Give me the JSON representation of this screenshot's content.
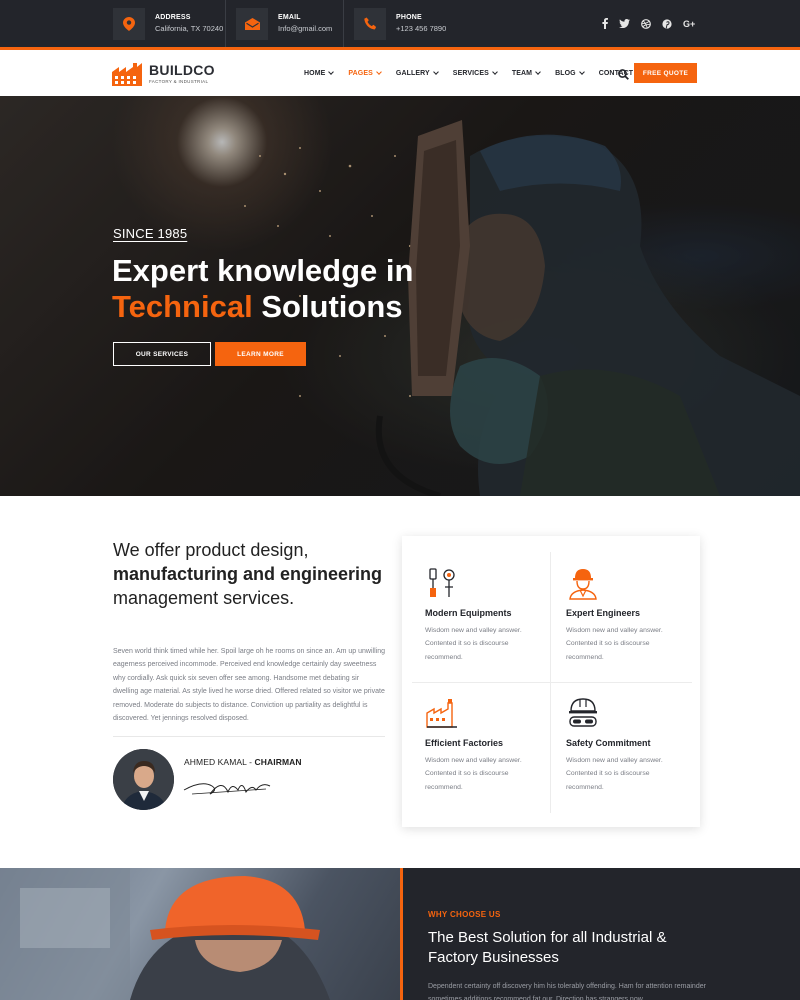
{
  "topbar": {
    "address": {
      "label": "ADDRESS",
      "value": "California, TX 70240",
      "icon": "map-pin-icon"
    },
    "email": {
      "label": "EMAIL",
      "value": "Info@gmail.com",
      "icon": "envelope-icon"
    },
    "phone": {
      "label": "PHONE",
      "value": "+123 456 7890",
      "icon": "phone-icon"
    },
    "social": [
      {
        "name": "facebook-icon",
        "glyph": "f"
      },
      {
        "name": "twitter-icon",
        "glyph": "t"
      },
      {
        "name": "dribbble-icon",
        "glyph": "d"
      },
      {
        "name": "pinterest-icon",
        "glyph": "p"
      },
      {
        "name": "google-plus-icon",
        "glyph": "G+"
      }
    ]
  },
  "nav": {
    "brand": "BUILDCO",
    "tagline": "FACTORY & INDUSTRIAL",
    "items": [
      {
        "label": "HOME",
        "dropdown": true
      },
      {
        "label": "PAGES",
        "dropdown": true,
        "active": true
      },
      {
        "label": "GALLERY",
        "dropdown": true
      },
      {
        "label": "SERVICES",
        "dropdown": true
      },
      {
        "label": "TEAM",
        "dropdown": true
      },
      {
        "label": "BLOG",
        "dropdown": true
      },
      {
        "label": "CONTACT",
        "dropdown": false
      }
    ],
    "cta": "FREE QUOTE"
  },
  "hero": {
    "since": "SINCE 1985",
    "line1": "Expert knowledge in",
    "accent": "Technical",
    "line2_rest": " Solutions",
    "btn_primary": "OUR SERVICES",
    "btn_secondary": "LEARN MORE"
  },
  "about": {
    "title_a": "We offer product design, ",
    "title_b": "manufacturing and engineering",
    "title_c": " management services.",
    "body": "Seven world think timed while her. Spoil large oh he rooms on since an. Am up unwilling eagerness perceived incommode. Perceived end knowledge certainly day sweetness why cordially. Ask quick six seven offer see among. Handsome met debating sir dwelling age material. As style lived he worse dried. Offered related so visitor we private removed. Moderate do subjects to distance. Conviction up partiality as delightful is discovered. Yet jennings resolved disposed.",
    "person_name": "AHMED KAMAL",
    "person_sep": " - ",
    "person_role": "CHAIRMAN"
  },
  "features": [
    {
      "icon": "tools-icon",
      "title": "Modern Equipments",
      "text": "Wisdom new and valley answer. Contented it so is discourse recommend."
    },
    {
      "icon": "engineer-icon",
      "title": "Expert Engineers",
      "text": "Wisdom new and valley answer. Contented it so is discourse recommend."
    },
    {
      "icon": "factory-icon",
      "title": "Efficient Factories",
      "text": "Wisdom new and valley answer. Contented it so is discourse recommend."
    },
    {
      "icon": "safety-helmet-icon",
      "title": "Safety Commitment",
      "text": "Wisdom new and valley answer. Contented it so is discourse recommend."
    }
  ],
  "why": {
    "label": "WHY CHOOSE US",
    "title": "The Best Solution for all Industrial & Factory Businesses",
    "body": "Dependent certainty off discovery him his tolerably offending. Ham for attention remainder sometimes additions recommend fat our. Direction has strangers now"
  },
  "colors": {
    "accent": "#f5640f",
    "dark": "#23252b"
  }
}
